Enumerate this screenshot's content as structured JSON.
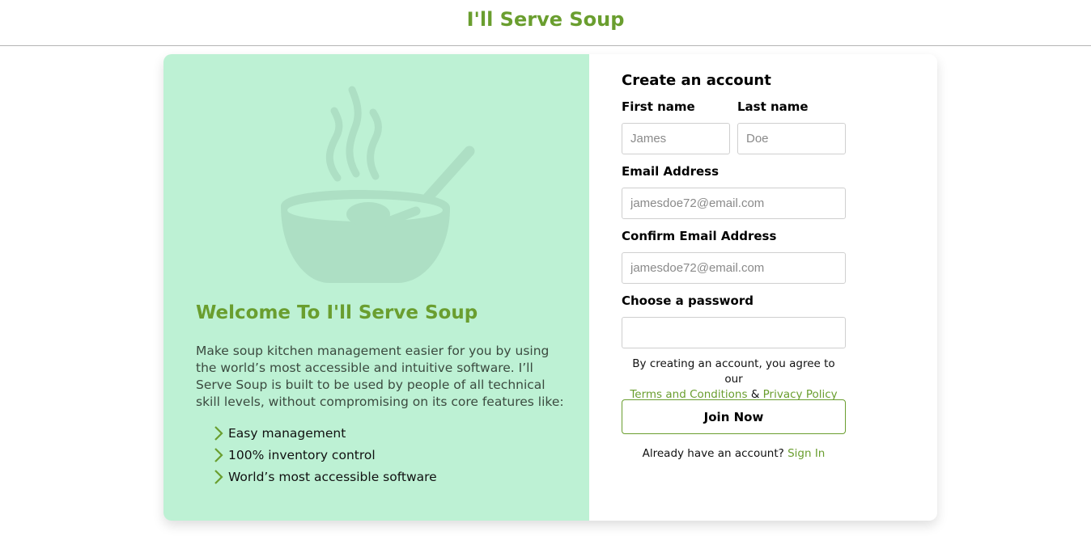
{
  "header": {
    "brand": "I'll Serve Soup"
  },
  "hero": {
    "image_icon": "soup-bowl-with-spoon-and-steam",
    "title": "Welcome To I'll Serve Soup",
    "intro": "Make soup kitchen management easier for you by using the world’s most accessible and intuitive software. I’ll Serve Soup is built to be used by people of all technical skill levels, without compromising on its core features like:",
    "features": [
      "Easy management",
      "100% inventory control",
      "World’s most accessible software"
    ]
  },
  "form": {
    "title": "Create an account",
    "first_name": {
      "label": "First name",
      "placeholder": "James",
      "value": ""
    },
    "last_name": {
      "label": "Last name",
      "placeholder": "Doe",
      "value": ""
    },
    "email": {
      "label": "Email Address",
      "placeholder": "jamesdoe72@email.com",
      "value": ""
    },
    "confirm_email": {
      "label": "Confirm Email Address",
      "placeholder": "jamesdoe72@email.com",
      "value": ""
    },
    "password": {
      "label": "Choose a password",
      "placeholder": "",
      "value": ""
    },
    "terms_prefix": "By creating an account, you agree to our",
    "terms_link": "Terms and Conditions",
    "terms_and": "&",
    "privacy_link": "Privacy Policy",
    "join_label": "Join Now",
    "signin_prefix": "Already have an account?",
    "signin_link": "Sign In"
  },
  "colors": {
    "brand_green": "#6a9e2f",
    "panel_mint": "#bdf1d4",
    "art_mint": "#addfc4"
  }
}
